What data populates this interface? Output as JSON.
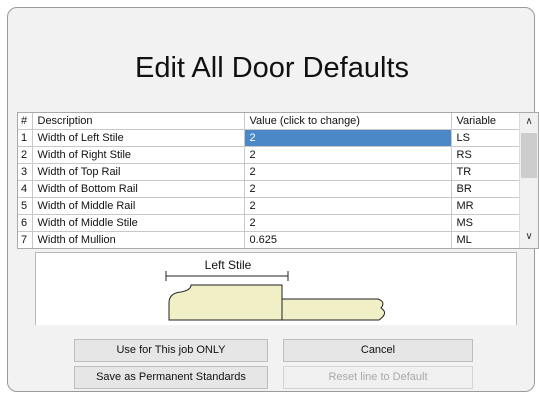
{
  "dialog": {
    "title": "Edit All Door Defaults"
  },
  "table": {
    "columns": [
      "#",
      "Description",
      "Value (click to change)",
      "Variable"
    ],
    "rows": [
      {
        "num": "1",
        "desc": "Width of Left Stile",
        "value": "2",
        "var": "LS"
      },
      {
        "num": "2",
        "desc": "Width of Right Stile",
        "value": "2",
        "var": "RS"
      },
      {
        "num": "3",
        "desc": "Width of Top Rail",
        "value": "2",
        "var": "TR"
      },
      {
        "num": "4",
        "desc": "Width of Bottom Rail",
        "value": "2",
        "var": "BR"
      },
      {
        "num": "5",
        "desc": "Width of Middle Rail",
        "value": "2",
        "var": "MR"
      },
      {
        "num": "6",
        "desc": "Width of Middle Stile",
        "value": "2",
        "var": "MS"
      },
      {
        "num": "7",
        "desc": "Width of Mullion",
        "value": "0.625",
        "var": "ML"
      }
    ],
    "selected_row": 1
  },
  "preview": {
    "label": "Left Stile",
    "profile_fill": "#f1efc6"
  },
  "buttons": {
    "use_job": "Use for This job ONLY",
    "cancel": "Cancel",
    "save_permanent": "Save as Permanent Standards",
    "reset_line": "Reset line to Default"
  },
  "colors": {
    "selection": "#4a88c7",
    "background": "#f2f2f2"
  }
}
